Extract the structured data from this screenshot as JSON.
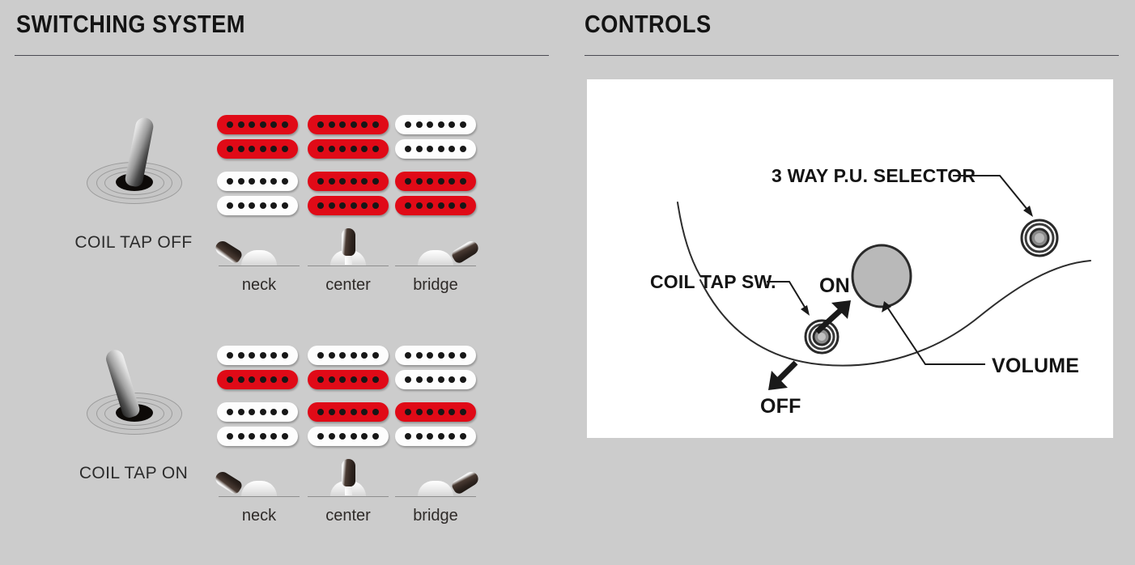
{
  "sections": {
    "switching": {
      "title": "SWITCHING SYSTEM"
    },
    "controls": {
      "title": "CONTROLS"
    }
  },
  "switching_rows": [
    {
      "id": "coil-tap-off",
      "label": "COIL TAP OFF",
      "toggle_state": "off",
      "pickup_rows": [
        {
          "cells": [
            {
              "position": "neck",
              "top": "red",
              "bottom": "red"
            },
            {
              "position": "center",
              "top": "red",
              "bottom": "red"
            },
            {
              "position": "bridge",
              "top": "white",
              "bottom": "white"
            }
          ]
        },
        {
          "cells": [
            {
              "position": "neck",
              "top": "white",
              "bottom": "white"
            },
            {
              "position": "center",
              "top": "red",
              "bottom": "red"
            },
            {
              "position": "bridge",
              "top": "red",
              "bottom": "red"
            }
          ]
        }
      ],
      "selector_positions": [
        {
          "label": "neck",
          "lever": "neck"
        },
        {
          "label": "center",
          "lever": "center"
        },
        {
          "label": "bridge",
          "lever": "bridge"
        }
      ]
    },
    {
      "id": "coil-tap-on",
      "label": "COIL TAP ON",
      "toggle_state": "on",
      "pickup_rows": [
        {
          "cells": [
            {
              "position": "neck",
              "top": "white",
              "bottom": "red"
            },
            {
              "position": "center",
              "top": "white",
              "bottom": "red"
            },
            {
              "position": "bridge",
              "top": "white",
              "bottom": "white"
            }
          ]
        },
        {
          "cells": [
            {
              "position": "neck",
              "top": "white",
              "bottom": "white"
            },
            {
              "position": "center",
              "top": "red",
              "bottom": "white"
            },
            {
              "position": "bridge",
              "top": "red",
              "bottom": "white"
            }
          ]
        }
      ],
      "selector_positions": [
        {
          "label": "neck",
          "lever": "neck"
        },
        {
          "label": "center",
          "lever": "center"
        },
        {
          "label": "bridge",
          "lever": "bridge"
        }
      ]
    }
  ],
  "controls_diagram": {
    "callouts": [
      {
        "name": "pu-selector",
        "text": "3 WAY P.U. SELECTOR"
      },
      {
        "name": "coil-tap-sw",
        "text": "COIL TAP SW."
      },
      {
        "name": "coil-tap-on",
        "text": "ON"
      },
      {
        "name": "coil-tap-off",
        "text": "OFF"
      },
      {
        "name": "volume",
        "text": "VOLUME"
      }
    ]
  },
  "colors": {
    "background": "#cccccc",
    "panel": "#ffffff",
    "coil_active": "#e00a17",
    "coil_inactive": "#fdfdfd",
    "pole": "#171717",
    "ink": "#141414",
    "rule": "#4a4a52"
  },
  "pole_count": 6
}
